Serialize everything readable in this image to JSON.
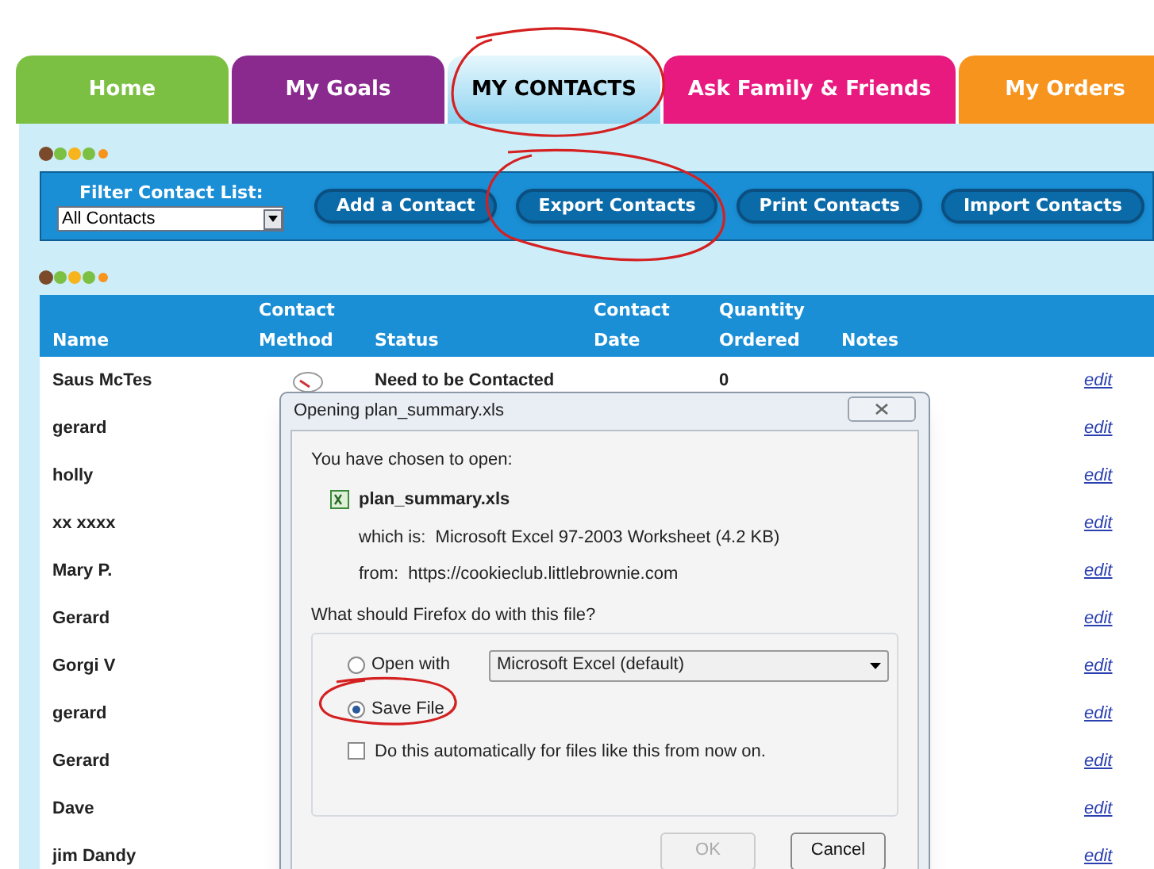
{
  "tabs": [
    {
      "label": "Home",
      "color": "#7cc043",
      "selected": false
    },
    {
      "label": "My Goals",
      "color": "#8a2a8f",
      "selected": false
    },
    {
      "label": "MY CONTACTS",
      "color": "#8fd3f0",
      "selected": true
    },
    {
      "label": "Ask Family & Friends",
      "color": "#e8197f",
      "selected": false
    },
    {
      "label": "My Orders",
      "color": "#f7941d",
      "selected": false
    }
  ],
  "filter": {
    "label": "Filter Contact List:",
    "value": "All Contacts"
  },
  "toolbar_buttons": [
    "Add a Contact",
    "Export Contacts",
    "Print Contacts",
    "Import Contacts"
  ],
  "table": {
    "columns": [
      "Name",
      "Contact Method",
      "Status",
      "Contact Date",
      "Quantity Ordered",
      "Notes"
    ],
    "rows": [
      {
        "name": "Saus McTes",
        "method_icon": true,
        "status": "Need to be Contacted",
        "quantity": "0",
        "action": "edit"
      },
      {
        "name": "gerard",
        "action": "edit"
      },
      {
        "name": "holly",
        "action": "edit"
      },
      {
        "name": "xx xxxx",
        "action": "edit"
      },
      {
        "name": "Mary P.",
        "action": "edit"
      },
      {
        "name": "Gerard",
        "action": "edit"
      },
      {
        "name": "Gorgi V",
        "action": "edit"
      },
      {
        "name": "gerard",
        "action": "edit"
      },
      {
        "name": "Gerard",
        "action": "edit"
      },
      {
        "name": "Dave",
        "action": "edit"
      },
      {
        "name": "jim Dandy",
        "action": "edit"
      }
    ]
  },
  "dialog": {
    "title": "Opening plan_summary.xls",
    "intro": "You have chosen to open:",
    "file_name": "plan_summary.xls",
    "which_is": "which is:  Microsoft Excel 97-2003 Worksheet (4.2 KB)",
    "from": "from:  https://cookieclub.littlebrownie.com",
    "question": "What should Firefox do with this file?",
    "options": [
      {
        "label": "Open with",
        "selected": false,
        "app": "Microsoft Excel (default)"
      },
      {
        "label": "Save File",
        "selected": true
      }
    ],
    "remember": {
      "label": "Do this automatically for files like this from now on.",
      "checked": false
    },
    "buttons": [
      {
        "label": "OK",
        "disabled": true
      },
      {
        "label": "Cancel",
        "disabled": false
      }
    ]
  }
}
